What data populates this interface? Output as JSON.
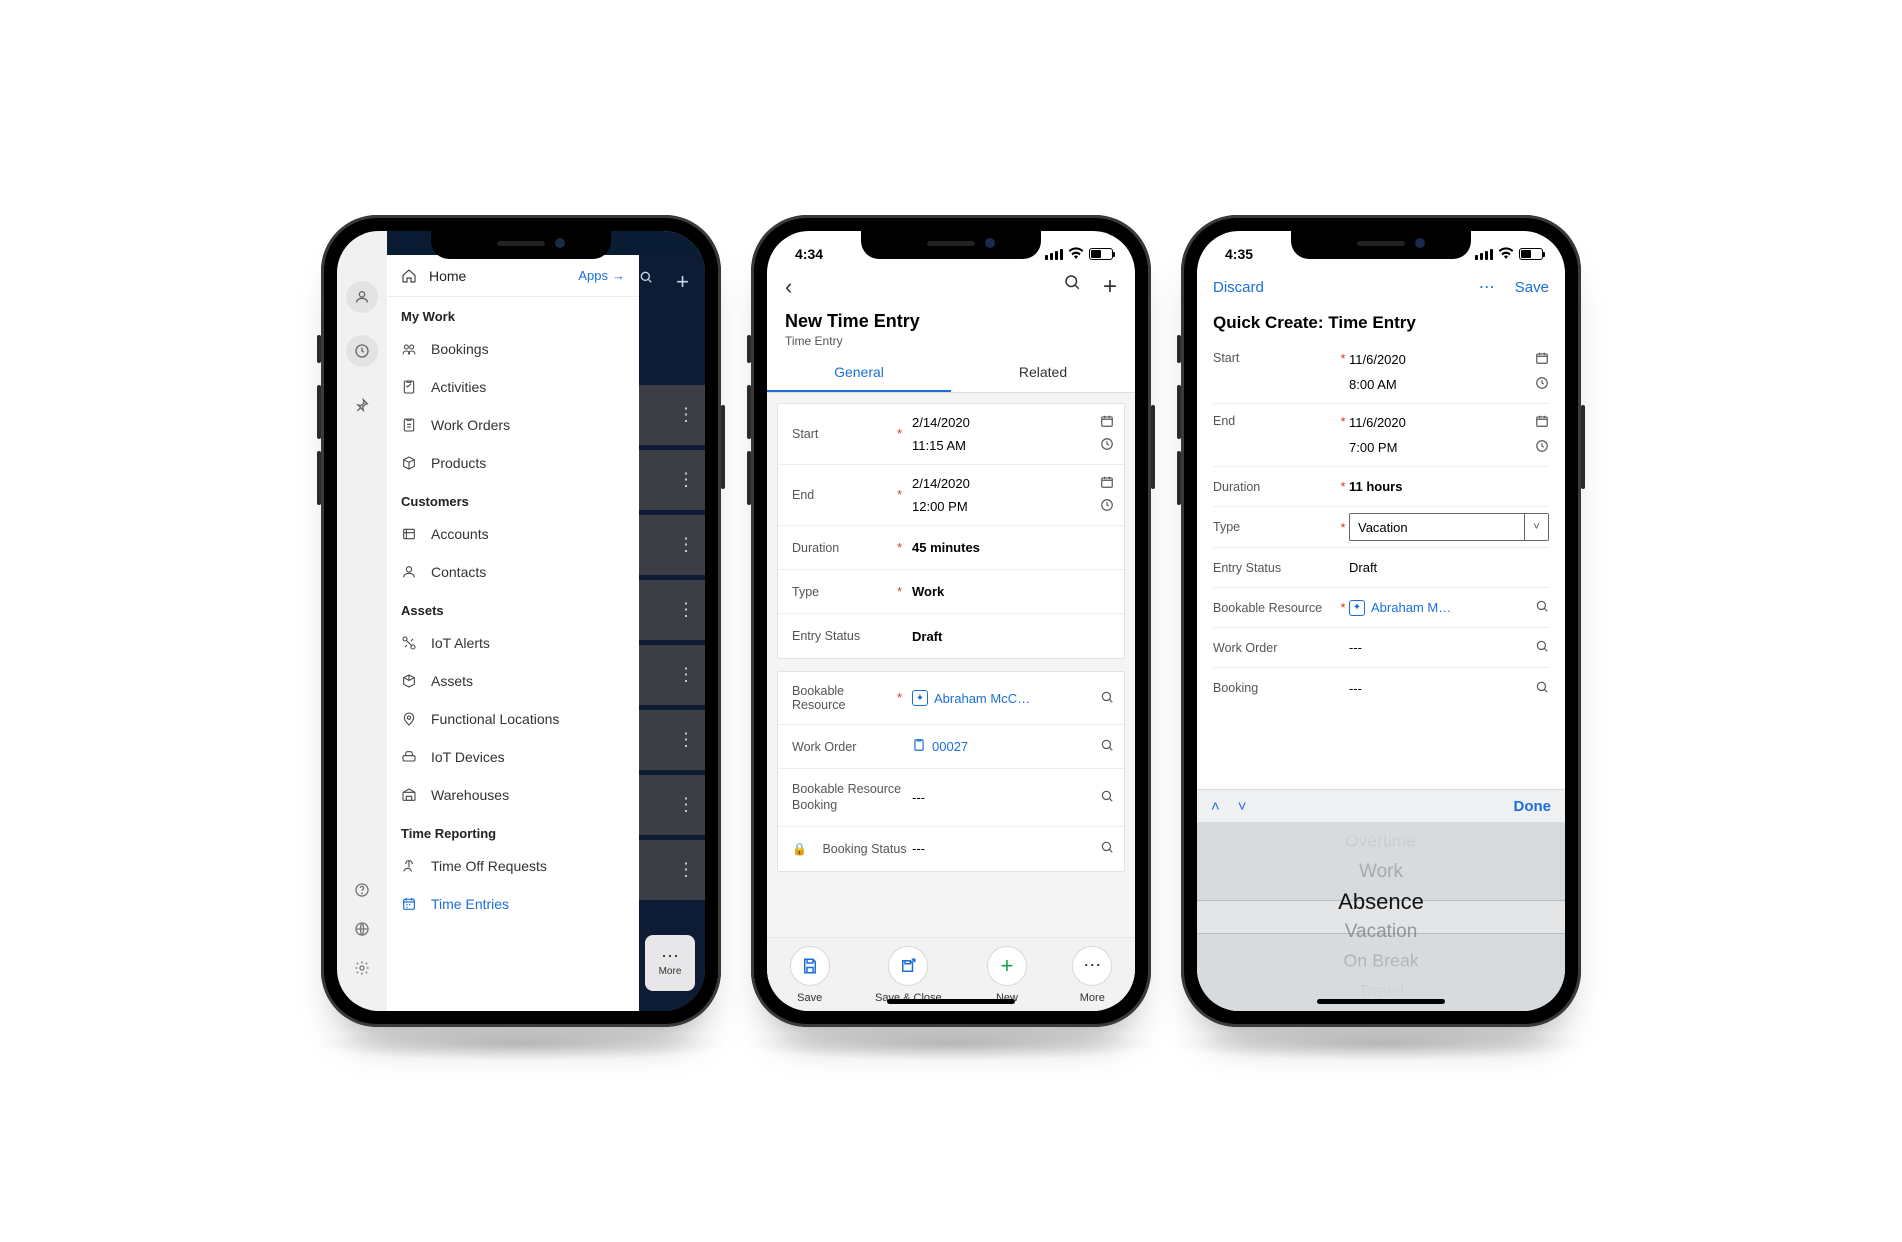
{
  "phone1": {
    "drawer": {
      "home": "Home",
      "apps": "Apps",
      "sections": [
        {
          "title": "My Work",
          "items": [
            "Bookings",
            "Activities",
            "Work Orders",
            "Products"
          ]
        },
        {
          "title": "Customers",
          "items": [
            "Accounts",
            "Contacts"
          ]
        },
        {
          "title": "Assets",
          "items": [
            "IoT Alerts",
            "Assets",
            "Functional Locations",
            "IoT Devices",
            "Warehouses"
          ]
        },
        {
          "title": "Time Reporting",
          "items": [
            "Time Off Requests",
            "Time Entries"
          ]
        }
      ],
      "active": "Time Entries"
    },
    "back_more": "More"
  },
  "phone2": {
    "time": "4:34",
    "title": "New Time Entry",
    "subtitle": "Time Entry",
    "tabs": {
      "general": "General",
      "related": "Related"
    },
    "fields": {
      "start_label": "Start",
      "start_date": "2/14/2020",
      "start_time": "11:15 AM",
      "end_label": "End",
      "end_date": "2/14/2020",
      "end_time": "12:00 PM",
      "duration_label": "Duration",
      "duration": "45 minutes",
      "type_label": "Type",
      "type": "Work",
      "status_label": "Entry Status",
      "status": "Draft",
      "resource_label": "Bookable Resource",
      "resource": "Abraham McC…",
      "workorder_label": "Work Order",
      "workorder": "00027",
      "booking_label": "Bookable Resource Booking",
      "booking": "---",
      "bookstatus_label": "Booking Status",
      "bookstatus": "---"
    },
    "footer": {
      "save": "Save",
      "saveclose": "Save & Close",
      "new": "New",
      "more": "More"
    }
  },
  "phone3": {
    "time": "4:35",
    "discard": "Discard",
    "save": "Save",
    "title": "Quick Create: Time Entry",
    "fields": {
      "start_label": "Start",
      "start_date": "11/6/2020",
      "start_time": "8:00 AM",
      "end_label": "End",
      "end_date": "11/6/2020",
      "end_time": "7:00 PM",
      "duration_label": "Duration",
      "duration": "11 hours",
      "type_label": "Type",
      "type": "Vacation",
      "status_label": "Entry Status",
      "status": "Draft",
      "resource_label": "Bookable Resource",
      "resource": "Abraham M…",
      "workorder_label": "Work Order",
      "workorder": "---",
      "booking_label": "Booking",
      "booking": "---"
    },
    "acc_done": "Done",
    "picker": [
      "Overtime",
      "Work",
      "Absence",
      "Vacation",
      "On Break",
      "Travel"
    ],
    "picker_selected": "Absence"
  }
}
